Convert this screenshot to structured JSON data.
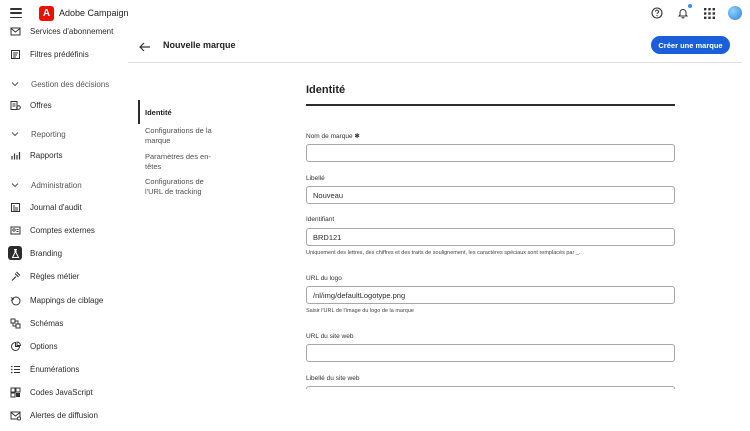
{
  "app": {
    "title": "Adobe Campaign"
  },
  "sidebar": {
    "items": [
      {
        "label": "Services d'abonnement",
        "icon": "mail-icon"
      },
      {
        "label": "Filtres prédéfinis",
        "icon": "filter-icon"
      },
      {
        "section": "Gestion des décisions"
      },
      {
        "label": "Offres",
        "icon": "offer-icon"
      },
      {
        "section": "Reporting"
      },
      {
        "label": "Rapports",
        "icon": "chart-icon"
      },
      {
        "section": "Administration"
      },
      {
        "label": "Journal d'audit",
        "icon": "audit-icon"
      },
      {
        "label": "Comptes externes",
        "icon": "accounts-icon"
      },
      {
        "label": "Branding",
        "icon": "branding-icon",
        "active": true
      },
      {
        "label": "Règles métier",
        "icon": "rules-icon"
      },
      {
        "label": "Mappings de ciblage",
        "icon": "mapping-icon"
      },
      {
        "label": "Schémas",
        "icon": "schema-icon"
      },
      {
        "label": "Options",
        "icon": "options-icon"
      },
      {
        "label": "Énumérations",
        "icon": "enum-icon"
      },
      {
        "label": "Codes JavaScript",
        "icon": "code-icon"
      },
      {
        "label": "Alertes de diffusion",
        "icon": "alert-icon"
      }
    ]
  },
  "header": {
    "title": "Nouvelle marque",
    "primary_button": "Créer une marque"
  },
  "section_nav": [
    {
      "label": "Identité",
      "active": true
    },
    {
      "label": "Configurations de la marque"
    },
    {
      "label": "Paramètres des en-têtes"
    },
    {
      "label": "Configurations de l'URL de tracking"
    }
  ],
  "form": {
    "heading": "Identité",
    "fields": {
      "brand_name": {
        "label": "Nom de marque ✱",
        "value": ""
      },
      "label": {
        "label": "Libellé",
        "value": "Nouveau"
      },
      "identifier": {
        "label": "Identifiant",
        "value": "BRD121",
        "help": "Uniquement des lettres, des chiffres et des traits de soulignement, les caractères spéciaux sont remplacés par _."
      },
      "logo_url": {
        "label": "URL du logo",
        "value": "/nl/img/defaultLogotype.png",
        "help": "Saisir l'URL de l'image du logo de la marque"
      },
      "website_url": {
        "label": "URL du site web",
        "value": ""
      },
      "website_label": {
        "label": "Libellé du site web",
        "value": ""
      }
    }
  },
  "colors": {
    "accent": "#1b5fd8",
    "brand": "#eb1000"
  }
}
